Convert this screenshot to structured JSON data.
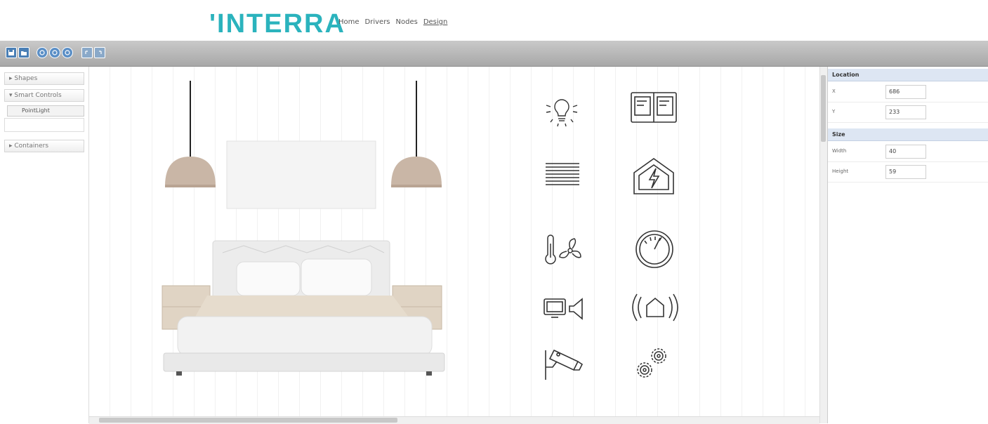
{
  "header": {
    "logo": "'INTERRA",
    "nav": [
      {
        "label": "Home"
      },
      {
        "label": "Drivers"
      },
      {
        "label": "Nodes"
      },
      {
        "label": "Design"
      }
    ]
  },
  "toolbar": {
    "icons": [
      "save-icon",
      "open-icon",
      "zoom-in-icon",
      "zoom-reset-icon",
      "zoom-out-icon",
      "undo-icon",
      "redo-icon"
    ]
  },
  "left_panel": {
    "sections": [
      {
        "label": "Shapes"
      },
      {
        "label": "Smart Controls"
      },
      {
        "label": "Containers"
      }
    ],
    "smart_controls_items": [
      {
        "label": "PointLight"
      }
    ]
  },
  "canvas": {
    "scene": "bedroom",
    "widgets": [
      "lightbulb-icon",
      "book-icon",
      "blinds-icon",
      "energy-house-icon",
      "thermostat-fan-icon",
      "gauge-icon",
      "tv-speaker-icon",
      "alarm-signal-icon",
      "cctv-camera-icon",
      "gears-icon"
    ]
  },
  "properties": {
    "location": {
      "title": "Location",
      "x_label": "X",
      "x_value": "686",
      "y_label": "Y",
      "y_value": "233"
    },
    "size": {
      "title": "Size",
      "width_label": "Width",
      "width_value": "40",
      "height_label": "Height",
      "height_value": "59"
    }
  },
  "colors": {
    "brand": "#2bb3bd",
    "toolbar": "#b5b5b5",
    "section_header": "#dde6f3"
  }
}
